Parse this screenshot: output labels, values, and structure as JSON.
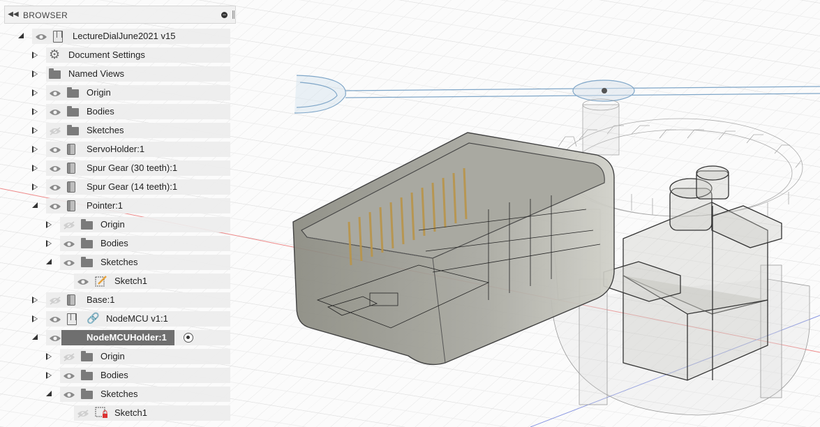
{
  "browser": {
    "title": "BROWSER",
    "items": [
      {
        "label": "LectureDialJune2021 v15"
      },
      {
        "label": "Document Settings"
      },
      {
        "label": "Named Views"
      },
      {
        "label": "Origin"
      },
      {
        "label": "Bodies"
      },
      {
        "label": "Sketches"
      },
      {
        "label": "ServoHolder:1"
      },
      {
        "label": "Spur Gear (30 teeth):1"
      },
      {
        "label": "Spur Gear (14 teeth):1"
      },
      {
        "label": "Pointer:1"
      },
      {
        "label": "Origin"
      },
      {
        "label": "Bodies"
      },
      {
        "label": "Sketches"
      },
      {
        "label": "Sketch1"
      },
      {
        "label": "Base:1"
      },
      {
        "label": "NodeMCU v1:1"
      },
      {
        "label": "NodeMCUHolder:1"
      },
      {
        "label": "Origin"
      },
      {
        "label": "Bodies"
      },
      {
        "label": "Sketches"
      },
      {
        "label": "Sketch1"
      }
    ]
  },
  "colors": {
    "selection": "#6f6f6f",
    "accent_red": "#e26a6a",
    "accent_blue": "#6a7fd6"
  }
}
